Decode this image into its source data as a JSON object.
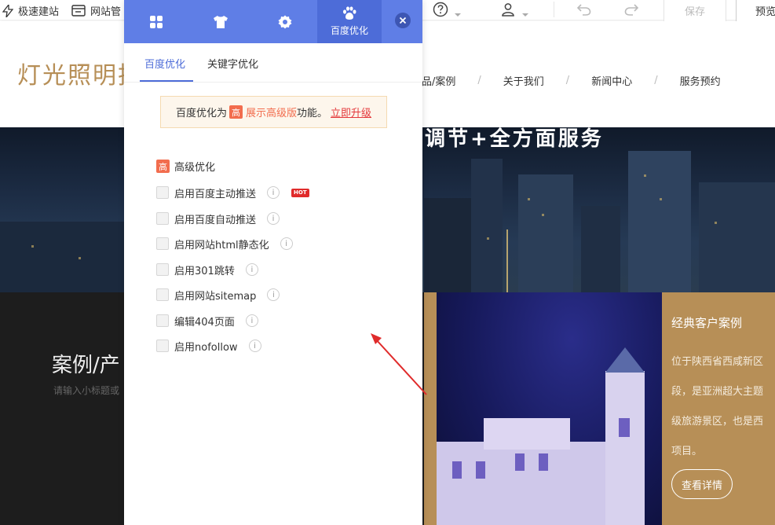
{
  "toolbar": {
    "quick_build": "极速建站",
    "site_manage": "网站管",
    "save": "保存",
    "preview": "预览"
  },
  "site": {
    "logo": "灯光照明技",
    "nav": [
      "品/案例",
      "关于我们",
      "新闻中心",
      "服务预约"
    ],
    "nav_separator": "/",
    "banner_title": "调节+全方面服务",
    "case_title": "案例/产",
    "case_subtitle": "请输入小标题或",
    "client_case_title": "经典客户案例",
    "client_case_lines": [
      "位于陕西省西咸新区",
      "段，是亚洲超大主题",
      "级旅游景区，也是西",
      "项目。"
    ],
    "detail_button": "查看详情"
  },
  "panel": {
    "active_tab_label": "百度优化",
    "subtabs": [
      "百度优化",
      "关键字优化"
    ],
    "notice": {
      "prefix": "百度优化为",
      "badge": "高",
      "highlight": "展示高级版",
      "suffix": "功能。",
      "link": "立即升级"
    },
    "advanced_badge": "高",
    "advanced_label": "高级优化",
    "hot_badge": "HOT",
    "info_glyph": "i",
    "options": [
      "启用百度主动推送",
      "启用百度自动推送",
      "启用网站html静态化",
      "启用301跳转",
      "启用网站sitemap",
      "编辑404页面",
      "启用nofollow"
    ]
  },
  "colors": {
    "panel_blue": "#5f7ee6",
    "panel_blue_active": "#4d6cd8",
    "brand_gold": "#b78f57",
    "warning_orange": "#f26d4e",
    "link_red": "#e4393c",
    "arrow_red": "#e02b2b"
  },
  "icons": {
    "panel_tabs": [
      "grid-icon",
      "shirt-icon",
      "gear-icon",
      "paw-icon"
    ],
    "close": "close-icon",
    "toolbar": [
      "lightning-icon",
      "monitor-icon",
      "help-icon",
      "user-icon",
      "undo-icon",
      "redo-icon"
    ]
  }
}
